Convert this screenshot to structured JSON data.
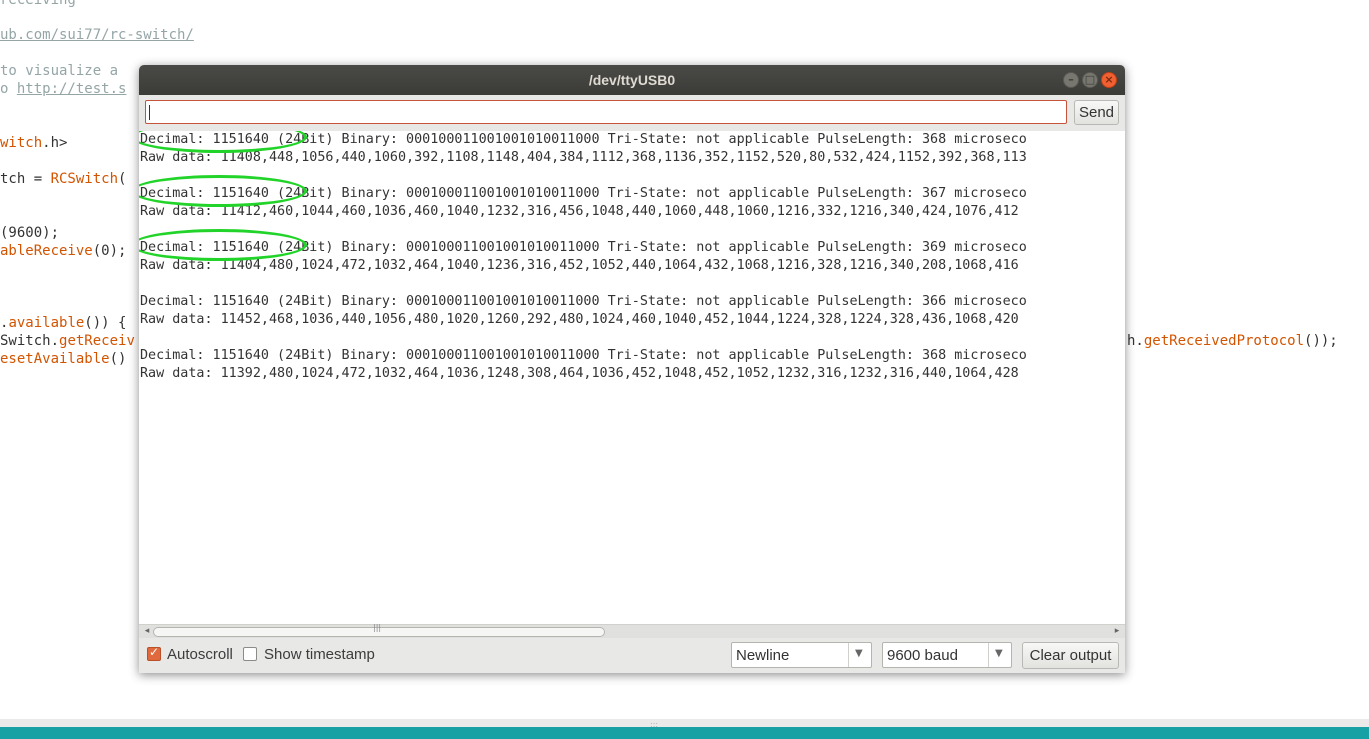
{
  "editor": {
    "lines": [
      {
        "parts": [
          {
            "t": "receiving",
            "c": "cmt"
          }
        ]
      },
      {
        "parts": [
          {
            "t": "ub.com/sui77/rc-switch/",
            "c": "link"
          }
        ]
      },
      {
        "parts": [
          {
            "t": "to visualize a ",
            "c": "cmt"
          }
        ]
      },
      {
        "parts": [
          {
            "t": "o ",
            "c": "cmt"
          },
          {
            "t": "http://test.s",
            "c": "link"
          }
        ]
      },
      {
        "parts": [
          {
            "t": "witch",
            "c": "kw"
          },
          {
            "t": ".h>",
            "c": ""
          }
        ]
      },
      {
        "parts": [
          {
            "t": "tch = ",
            "c": ""
          },
          {
            "t": "RCSwitch",
            "c": "kw"
          },
          {
            "t": "(",
            "c": ""
          }
        ]
      },
      {
        "parts": [
          {
            "t": "(9600);",
            "c": ""
          }
        ]
      },
      {
        "parts": [
          {
            "t": "ableReceive",
            "c": "kw2"
          },
          {
            "t": "(0);",
            "c": ""
          }
        ]
      },
      {
        "parts": [
          {
            "t": ".",
            "c": ""
          },
          {
            "t": "available",
            "c": "kw2"
          },
          {
            "t": "()) {",
            "c": ""
          }
        ]
      },
      {
        "parts": [
          {
            "t": "Switch.",
            "c": ""
          },
          {
            "t": "getReceiv",
            "c": "kw2"
          }
        ]
      },
      {
        "parts": [
          {
            "t": "esetAvailable",
            "c": "kw2"
          },
          {
            "t": "()",
            "c": ""
          }
        ]
      },
      {
        "parts": [
          {
            "t": "h.",
            "c": ""
          },
          {
            "t": "getReceivedProtocol",
            "c": "kw2"
          },
          {
            "t": "());",
            "c": ""
          }
        ]
      }
    ]
  },
  "window": {
    "title": "/dev/ttyUSB0",
    "buttons": {
      "minimize": "–",
      "maximize": "□",
      "close": "×"
    }
  },
  "input": {
    "value": ""
  },
  "send_label": "Send",
  "output": {
    "lines": [
      "Decimal: 1151640 (24Bit) Binary: 000100011001001010011000 Tri-State: not applicable PulseLength: 368 microseco",
      "Raw data: 11408,448,1056,440,1060,392,1108,1148,404,384,1112,368,1136,352,1152,520,80,532,424,1152,392,368,113",
      "Decimal: 1151640 (24Bit) Binary: 000100011001001010011000 Tri-State: not applicable PulseLength: 367 microseco",
      "Raw data: 11412,460,1044,460,1036,460,1040,1232,316,456,1048,440,1060,448,1060,1216,332,1216,340,424,1076,412",
      "Decimal: 1151640 (24Bit) Binary: 000100011001001010011000 Tri-State: not applicable PulseLength: 369 microseco",
      "Raw data: 11404,480,1024,472,1032,464,1040,1236,316,452,1052,440,1064,432,1068,1216,328,1216,340,208,1068,416",
      "Decimal: 1151640 (24Bit) Binary: 000100011001001010011000 Tri-State: not applicable PulseLength: 366 microseco",
      "Raw data: 11452,468,1036,440,1056,480,1020,1260,292,480,1024,460,1040,452,1044,1224,328,1224,328,436,1068,420",
      "Decimal: 1151640 (24Bit) Binary: 000100011001001010011000 Tri-State: not applicable PulseLength: 368 microseco",
      "Raw data: 11392,480,1024,472,1032,464,1036,1248,308,464,1036,452,1048,452,1052,1232,316,1232,316,440,1064,428"
    ]
  },
  "controls": {
    "autoscroll": {
      "label": "Autoscroll",
      "checked": true
    },
    "show_timestamp": {
      "label": "Show timestamp",
      "checked": false
    },
    "line_ending": {
      "selected": "Newline"
    },
    "baud_rate": {
      "selected": "9600 baud"
    },
    "clear_label": "Clear output"
  },
  "colors": {
    "highlight": "#22d42a",
    "accent": "#e06a3e",
    "statusbar": "#17a1a5"
  }
}
